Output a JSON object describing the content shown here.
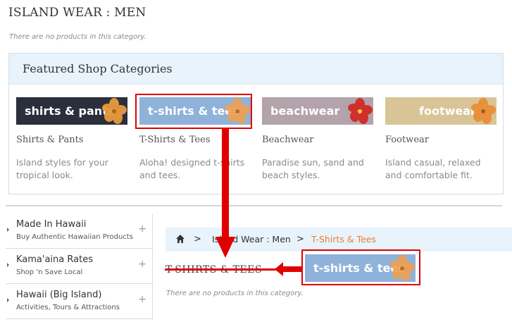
{
  "page": {
    "title": "ISLAND WEAR : MEN",
    "empty_message": "There are no products in this category."
  },
  "featured": {
    "heading": "Featured Shop Categories",
    "categories": [
      {
        "banner": "shirts & pants",
        "name": "Shirts & Pants",
        "desc": "Island styles for your tropical look.",
        "banner_color": "#2b2f3c",
        "flower_color": "#e89a3a"
      },
      {
        "banner": "t-shirts & tees",
        "name": "T-Shirts & Tees",
        "desc": "Aloha! designed t-shirts and tees.",
        "banner_color": "#8fb2da",
        "flower_color": "#f0a050"
      },
      {
        "banner": "beachwear",
        "name": "Beachwear",
        "desc": "Paradise sun, sand and beach styles.",
        "banner_color": "#b3a3ab",
        "flower_color": "#d0302a"
      },
      {
        "banner": "footwear",
        "name": "Footwear",
        "desc": "Island casual, relaxed and comfortable fit.",
        "banner_color": "#d9c497",
        "flower_color": "#e8903a"
      }
    ]
  },
  "sidebar": {
    "items": [
      {
        "title": "Made In Hawaii",
        "subtitle": "Buy Authentic Hawaiian Products",
        "expand": "+"
      },
      {
        "title": "Kama'aina Rates",
        "subtitle": "Shop 'n Save Local",
        "expand": "+"
      },
      {
        "title": "Hawaii (Big Island)",
        "subtitle": "Activities, Tours & Attractions",
        "expand": "+"
      }
    ]
  },
  "breadcrumb": {
    "home_icon": "home-icon",
    "separator": ">",
    "items": [
      "Island Wear : Men",
      "T-Shirts & Tees"
    ]
  },
  "subcategory": {
    "title": "T-SHIRTS & TEES",
    "banner": "t-shirts & tees",
    "empty_message": "There are no products in this category."
  },
  "colors": {
    "annotation_red": "#e00000",
    "breadcrumb_current": "#e67e34",
    "header_bg": "#e9f3fb"
  }
}
